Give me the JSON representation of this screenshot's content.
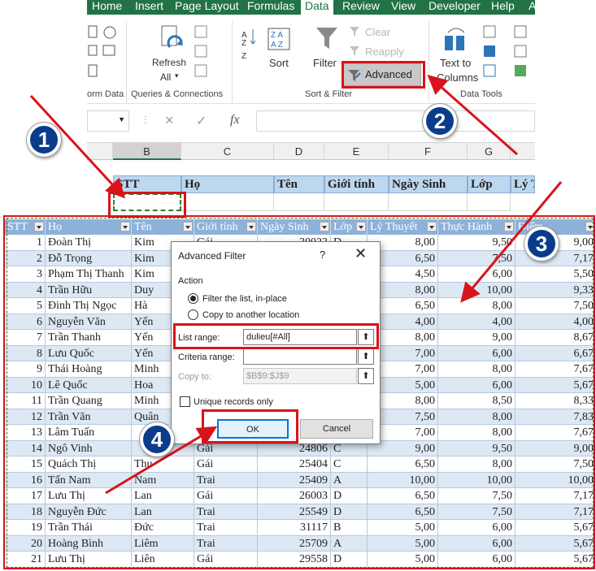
{
  "ribbon": {
    "tabs": [
      "Home",
      "Insert",
      "Page Layout",
      "Formulas",
      "Data",
      "Review",
      "View",
      "Developer",
      "Help",
      "A"
    ],
    "active_tab": "Data",
    "refresh_all": "Refresh\nAll",
    "refresh_line1": "Refresh",
    "refresh_line2": "All",
    "sort": "Sort",
    "filter": "Filter",
    "clear": "Clear",
    "reapply": "Reapply",
    "advanced": "Advanced",
    "text_to_columns_1": "Text to",
    "text_to_columns_2": "Columns",
    "groups": {
      "form_data": "orm Data",
      "queries": "Queries & Connections",
      "sort_filter": "Sort & Filter",
      "data_tools": "Data Tools"
    }
  },
  "formula_bar": {
    "fx": "fx",
    "cancel": "×",
    "confirm": "✓"
  },
  "columns": [
    "B",
    "C",
    "D",
    "E",
    "F",
    "G"
  ],
  "criteria_headers": [
    "STT",
    "Họ",
    "Tên",
    "Giới tính",
    "Ngày Sinh",
    "Lớp",
    "Lý T"
  ],
  "table": {
    "headers": [
      "STT",
      "Họ",
      "Tên",
      "Giới tính",
      "Ngày Sinh",
      "Lớp",
      "Lý Thuyết",
      "Thực Hành",
      "Điểm"
    ],
    "rows": [
      [
        "1",
        "Đoàn Thị",
        "Kim",
        "Gái",
        "30023",
        "D",
        "8,00",
        "9,50",
        "9,00"
      ],
      [
        "2",
        "Đỗ Trọng",
        "Kim",
        "",
        "",
        "",
        "6,50",
        "7,50",
        "7,17"
      ],
      [
        "3",
        "Phạm Thị Thanh",
        "Kim",
        "",
        "",
        "",
        "4,50",
        "6,00",
        "5,50"
      ],
      [
        "4",
        "Trần Hữu",
        "Duy",
        "",
        "",
        "",
        "8,00",
        "10,00",
        "9,33"
      ],
      [
        "5",
        "Đinh Thị Ngọc",
        "Hà",
        "",
        "",
        "",
        "6,50",
        "8,00",
        "7,50"
      ],
      [
        "6",
        "Nguyễn Văn",
        "Yến",
        "",
        "",
        "",
        "4,00",
        "4,00",
        "4,00"
      ],
      [
        "7",
        "Trần Thanh",
        "Yến",
        "",
        "",
        "",
        "8,00",
        "9,00",
        "8,67"
      ],
      [
        "8",
        "Lưu Quốc",
        "Yến",
        "",
        "",
        "",
        "7,00",
        "6,00",
        "6,67"
      ],
      [
        "9",
        "Thái Hoàng",
        "Minh",
        "",
        "",
        "",
        "7,00",
        "8,00",
        "7,67"
      ],
      [
        "10",
        "Lê Quốc",
        "Hoa",
        "",
        "",
        "",
        "5,00",
        "6,00",
        "5,67"
      ],
      [
        "11",
        "Trần Quang",
        "Minh",
        "",
        "",
        "",
        "8,00",
        "8,50",
        "8,33"
      ],
      [
        "12",
        "Trần Văn",
        "Quân",
        "",
        "",
        "",
        "7,50",
        "8,00",
        "7,83"
      ],
      [
        "13",
        "Lâm Tuấn",
        "",
        "",
        "",
        "",
        "7,00",
        "8,00",
        "7,67"
      ],
      [
        "14",
        "Ngô Vinh",
        "",
        "Gái",
        "24806",
        "C",
        "9,00",
        "9,50",
        "9,00"
      ],
      [
        "15",
        "Quách Thị",
        "Thu",
        "Gái",
        "25404",
        "C",
        "6,50",
        "8,00",
        "7,50"
      ],
      [
        "16",
        "Tấn Nam",
        "Nam",
        "Trai",
        "25409",
        "A",
        "10,00",
        "10,00",
        "10,00"
      ],
      [
        "17",
        "Lưu Thị",
        "Lan",
        "Gái",
        "26003",
        "D",
        "6,50",
        "7,50",
        "7,17"
      ],
      [
        "18",
        "Nguyễn Đức",
        "Lan",
        "Trai",
        "25549",
        "D",
        "6,50",
        "7,50",
        "7,17"
      ],
      [
        "19",
        "Trần Thái",
        "Đức",
        "Trai",
        "31117",
        "B",
        "5,00",
        "6,00",
        "5,67"
      ],
      [
        "20",
        "Hoàng Bình",
        "Liêm",
        "Trai",
        "25709",
        "A",
        "5,00",
        "6,00",
        "5,67"
      ],
      [
        "21",
        "Lưu Thị",
        "Liên",
        "Gái",
        "29558",
        "D",
        "5,00",
        "6,00",
        "5,67"
      ]
    ]
  },
  "dialog": {
    "title": "Advanced Filter",
    "help": "?",
    "close": "✕",
    "action_label": "Action",
    "option_inplace": "Filter the list, in-place",
    "option_copy": "Copy to another location",
    "list_range_label": "List range:",
    "list_range_value": "dulieu[#All]",
    "criteria_range_label": "Criteria range:",
    "criteria_range_value": "",
    "copy_to_label": "Copy to:",
    "copy_to_value": "$B$9:$J$9",
    "unique_label": "Unique records only",
    "ok": "OK",
    "cancel": "Cancel"
  },
  "steps": [
    "1",
    "2",
    "3",
    "4"
  ],
  "colors": {
    "excel_green": "#217346",
    "highlight_red": "#d9131b",
    "badge_blue": "#0b3c8c",
    "table_header": "#8eb1d9",
    "band": "#dde8f5"
  }
}
